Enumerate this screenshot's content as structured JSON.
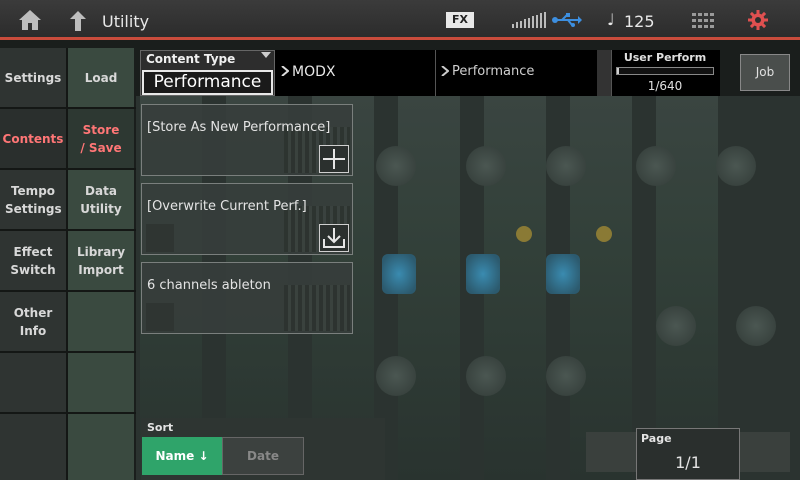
{
  "header": {
    "title": "Utility",
    "fx_label": "FX",
    "tempo_symbol": "♩",
    "tempo": "125",
    "accent_color": "#c94c3c"
  },
  "sidebar": {
    "col1": [
      {
        "label": "Settings",
        "active": false
      },
      {
        "label": "Contents",
        "active": true
      },
      {
        "label": "Tempo Settings",
        "active": false
      },
      {
        "label": "Effect Switch",
        "active": false
      },
      {
        "label": "Other Info",
        "active": false
      },
      {
        "label": "",
        "active": false
      },
      {
        "label": "",
        "active": false
      }
    ],
    "col2": [
      {
        "label": "Load",
        "active": false
      },
      {
        "label": "Store / Save",
        "active": true
      },
      {
        "label": "Data Utility",
        "active": false
      },
      {
        "label": "Library Import",
        "active": false
      },
      {
        "label": "",
        "active": false
      },
      {
        "label": "",
        "active": false
      },
      {
        "label": "",
        "active": false
      }
    ],
    "active_color": "#ff7676"
  },
  "content_type": {
    "label": "Content Type",
    "value": "Performance"
  },
  "path": {
    "level1": "MODX",
    "level2": "Performance"
  },
  "user_perform": {
    "title": "User Perform",
    "count": "1/640",
    "fill": 0.0016
  },
  "job_label": "Job",
  "items": [
    {
      "label": "[Store As New Performance]",
      "icon": "plus-icon"
    },
    {
      "label": "[Overwrite Current Perf.]",
      "icon": "overwrite-icon"
    },
    {
      "label": "6 channels ableton",
      "icon": ""
    }
  ],
  "sort": {
    "label": "Sort",
    "name_label": "Name ↓",
    "date_label": "Date",
    "active_color": "#2fa46a"
  },
  "page": {
    "label": "Page",
    "value": "1/1"
  }
}
